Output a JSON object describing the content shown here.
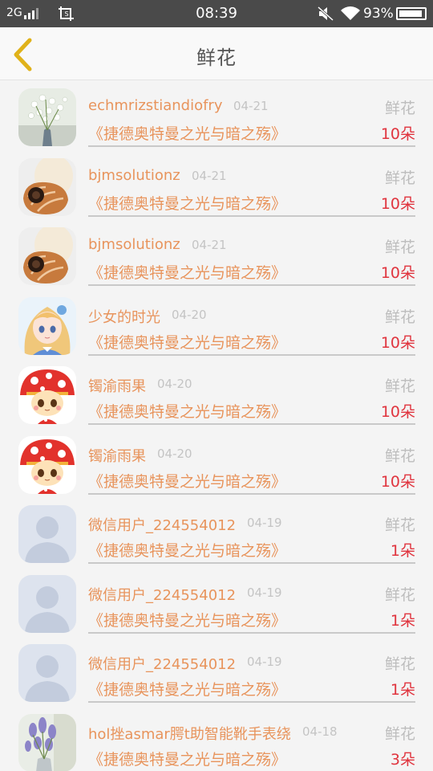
{
  "status_bar": {
    "network": "2G",
    "time": "08:39",
    "battery_percent": "93%",
    "battery_level": 0.93,
    "icons": [
      "signal-icon",
      "screenshot-icon",
      "mute-icon",
      "wifi-icon",
      "battery-icon"
    ]
  },
  "header": {
    "title": "鲜花",
    "back_icon": "chevron-left-icon"
  },
  "colors": {
    "accent": "#e8945c",
    "count": "#e0343e",
    "back_arrow": "#e0b21a",
    "status_bar_bg": "#4a4a4a"
  },
  "items": [
    {
      "name": "echmrizstiandiofry",
      "date": "04-21",
      "gift": "鲜花",
      "book": "《捷德奥特曼之光与暗之殇》",
      "count": "10朵",
      "avatar": "flowers-white"
    },
    {
      "name": "bjmsolutionz",
      "date": "04-21",
      "gift": "鲜花",
      "book": "《捷德奥特曼之光与暗之殇》",
      "count": "10朵",
      "avatar": "shell"
    },
    {
      "name": "bjmsolutionz",
      "date": "04-21",
      "gift": "鲜花",
      "book": "《捷德奥特曼之光与暗之殇》",
      "count": "10朵",
      "avatar": "shell"
    },
    {
      "name": "少女的时光",
      "date": "04-20",
      "gift": "鲜花",
      "book": "《捷德奥特曼之光与暗之殇》",
      "count": "10朵",
      "avatar": "anime-girl"
    },
    {
      "name": "镯渝雨果",
      "date": "04-20",
      "gift": "鲜花",
      "book": "《捷德奥特曼之光与暗之殇》",
      "count": "10朵",
      "avatar": "mushroom-girl"
    },
    {
      "name": "镯渝雨果",
      "date": "04-20",
      "gift": "鲜花",
      "book": "《捷德奥特曼之光与暗之殇》",
      "count": "10朵",
      "avatar": "mushroom-girl"
    },
    {
      "name": "微信用户_224554012",
      "date": "04-19",
      "gift": "鲜花",
      "book": "《捷德奥特曼之光与暗之殇》",
      "count": "1朵",
      "avatar": "default-user"
    },
    {
      "name": "微信用户_224554012",
      "date": "04-19",
      "gift": "鲜花",
      "book": "《捷德奥特曼之光与暗之殇》",
      "count": "1朵",
      "avatar": "default-user"
    },
    {
      "name": "微信用户_224554012",
      "date": "04-19",
      "gift": "鲜花",
      "book": "《捷德奥特曼之光与暗之殇》",
      "count": "1朵",
      "avatar": "default-user"
    },
    {
      "name": "hol挫asmar腭t助智能靴手表绕",
      "date": "04-18",
      "gift": "鲜花",
      "book": "《捷德奥特曼之光与暗之殇》",
      "count": "3朵",
      "avatar": "flowers-lavender"
    }
  ]
}
